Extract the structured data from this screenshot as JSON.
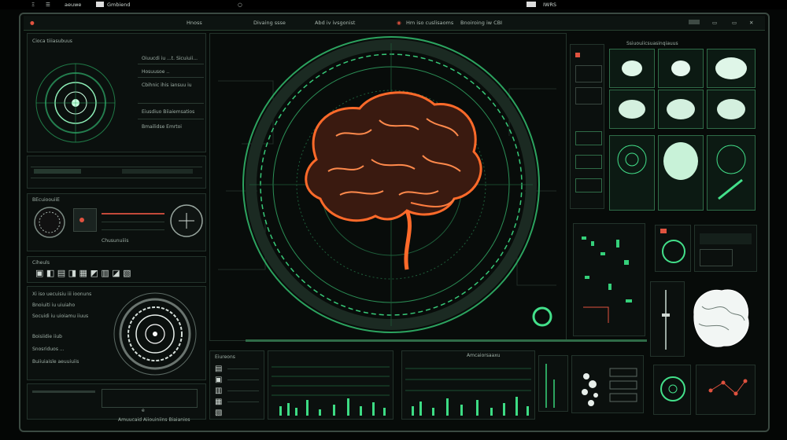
{
  "status_bar": {
    "item1": "Ξ",
    "item2": "Gmbiend",
    "item3": "aeuwe",
    "right": "IWRS"
  },
  "header": {
    "tab1": "Hnoss",
    "tab2": "Divaing ssse",
    "tab3": "Abd iv ivsgonist",
    "tab4": "Hm iso cuslisaoms",
    "tab5": "Bnoiroing iw CBI"
  },
  "left_top": {
    "title": "Cioca tiiiasubuus",
    "rows": [
      "Oiuucdi iu ...t. Sicuiuii...",
      "Hosuusoe ..",
      "Cbihnic ihis iansuu iu",
      "Eiusdiuo Biiaiemsatios",
      "Bmailidse Emrtoi"
    ]
  },
  "left_mid": {
    "title": "BEcuioouiiE",
    "caption": "Chusunuiiis"
  },
  "left_lower": {
    "title": "Ciheuls",
    "rows": [
      "Xi iso uecuisiu iii ioonuns",
      "Bnoiuiti iu uiuiaho",
      "Socuidi iu uioiamu iiuus",
      "Boisiidie iiub",
      "Snosriduos ...",
      "Buiiuiaisle aeuuiuiis"
    ]
  },
  "bottom_left": {
    "caption": "Amuucaid Aiiouiniins Biaianios",
    "page": "e"
  },
  "right_top": {
    "title": "Ssiuouiicsuasinqiauus"
  },
  "bottom_center": {
    "title": "Eiureons",
    "panel_title": "Amcaiorsaaxu"
  },
  "colors": {
    "accent_green": "#35d07a",
    "brain_orange": "#ff6a2a",
    "panel_bg": "#0b100e",
    "frame": "#3b4a42"
  }
}
